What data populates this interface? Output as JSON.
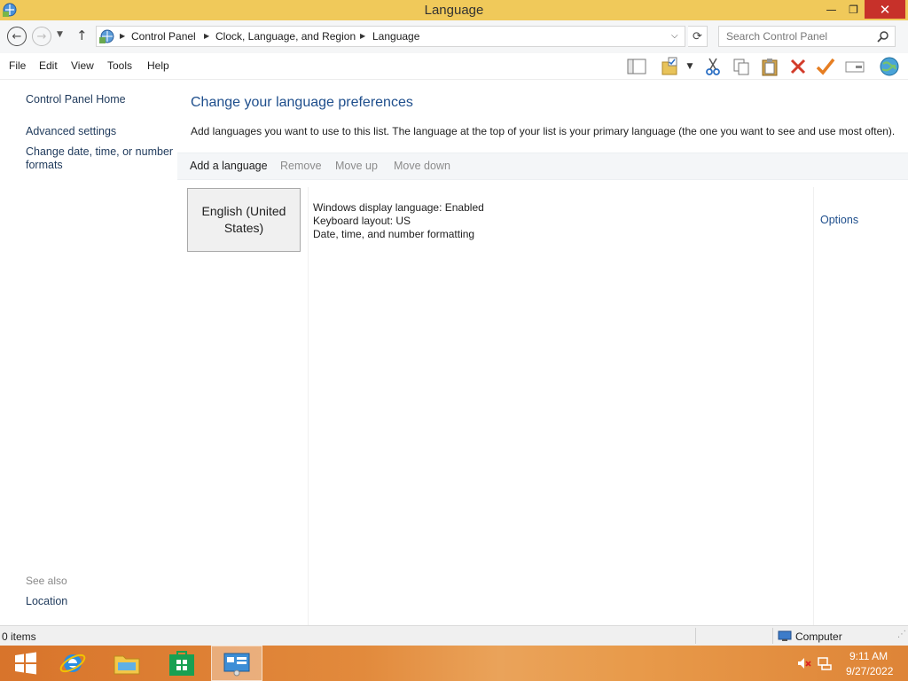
{
  "window": {
    "title": "Language",
    "minimize_glyph": "—",
    "maximize_glyph": "❐",
    "close_glyph": "✕"
  },
  "address": {
    "crumbs": [
      "Control Panel",
      "Clock, Language, and Region",
      "Language"
    ],
    "search_placeholder": "Search Control Panel"
  },
  "menu": [
    "File",
    "Edit",
    "View",
    "Tools",
    "Help"
  ],
  "toolbar_icons": [
    "layout-icon",
    "properties-icon",
    "dropdown-icon",
    "cut-icon",
    "copy-icon",
    "paste-icon",
    "delete-icon",
    "check-icon",
    "rename-icon",
    "globe-icon"
  ],
  "sidebar": {
    "home": "Control Panel Home",
    "advanced": "Advanced settings",
    "change_formats_line1": "Change date, time, or number",
    "change_formats_line2": "formats",
    "see_also": "See also",
    "location": "Location"
  },
  "main": {
    "heading": "Change your language preferences",
    "description": "Add languages you want to use to this list. The language at the top of your list is your primary language (the one you want to see and use most often).",
    "commands": {
      "add": "Add a language",
      "remove": "Remove",
      "move_up": "Move up",
      "move_down": "Move down"
    },
    "language": {
      "name": "English (United States)",
      "details": [
        "Windows display language: Enabled",
        "Keyboard layout: US",
        "Date, time, and number formatting"
      ],
      "options": "Options"
    }
  },
  "status": {
    "items": "0 items",
    "zone": "Computer"
  },
  "taskbar": {
    "apps": [
      "start-icon",
      "internet-explorer-icon",
      "file-explorer-icon",
      "store-icon",
      "control-panel-icon"
    ],
    "time": "9:11 AM",
    "date": "9/27/2022"
  },
  "colors": {
    "titlebar": "#f0c95a",
    "close": "#c7312a",
    "link": "#1e4e8c",
    "taskbar": "#e28a3c"
  }
}
